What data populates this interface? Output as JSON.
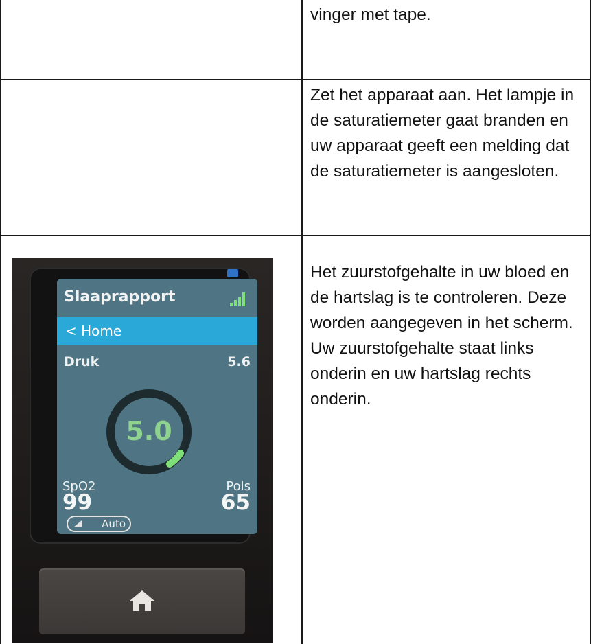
{
  "rows": [
    {
      "text": "vinger met tape."
    },
    {
      "text": "Zet het apparaat aan. Het lampje in de saturatiemeter gaat branden en uw apparaat geeft een melding dat de saturatiemeter is aangesloten."
    },
    {
      "text": "Het zuurstofgehalte in uw bloed en de hartslag is te controleren. Deze worden aangegeven in het scherm. Uw zuurstofgehalte staat links onderin en uw hartslag rechts onderin."
    }
  ],
  "device": {
    "title": "Slaaprapport",
    "home_label": "< Home",
    "pressure_label": "Druk",
    "pressure_value": "5.6",
    "center_value": "5.0",
    "spo2_label": "SpO2",
    "spo2_value": "99",
    "pulse_label": "Pols",
    "pulse_value": "65",
    "mode_label": "Auto",
    "icons": [
      "signal-icon",
      "home-icon"
    ],
    "colors": {
      "screen": "#4f7584",
      "title_bar": "#2aa8d8",
      "ring_accent": "#7fe07a"
    }
  }
}
